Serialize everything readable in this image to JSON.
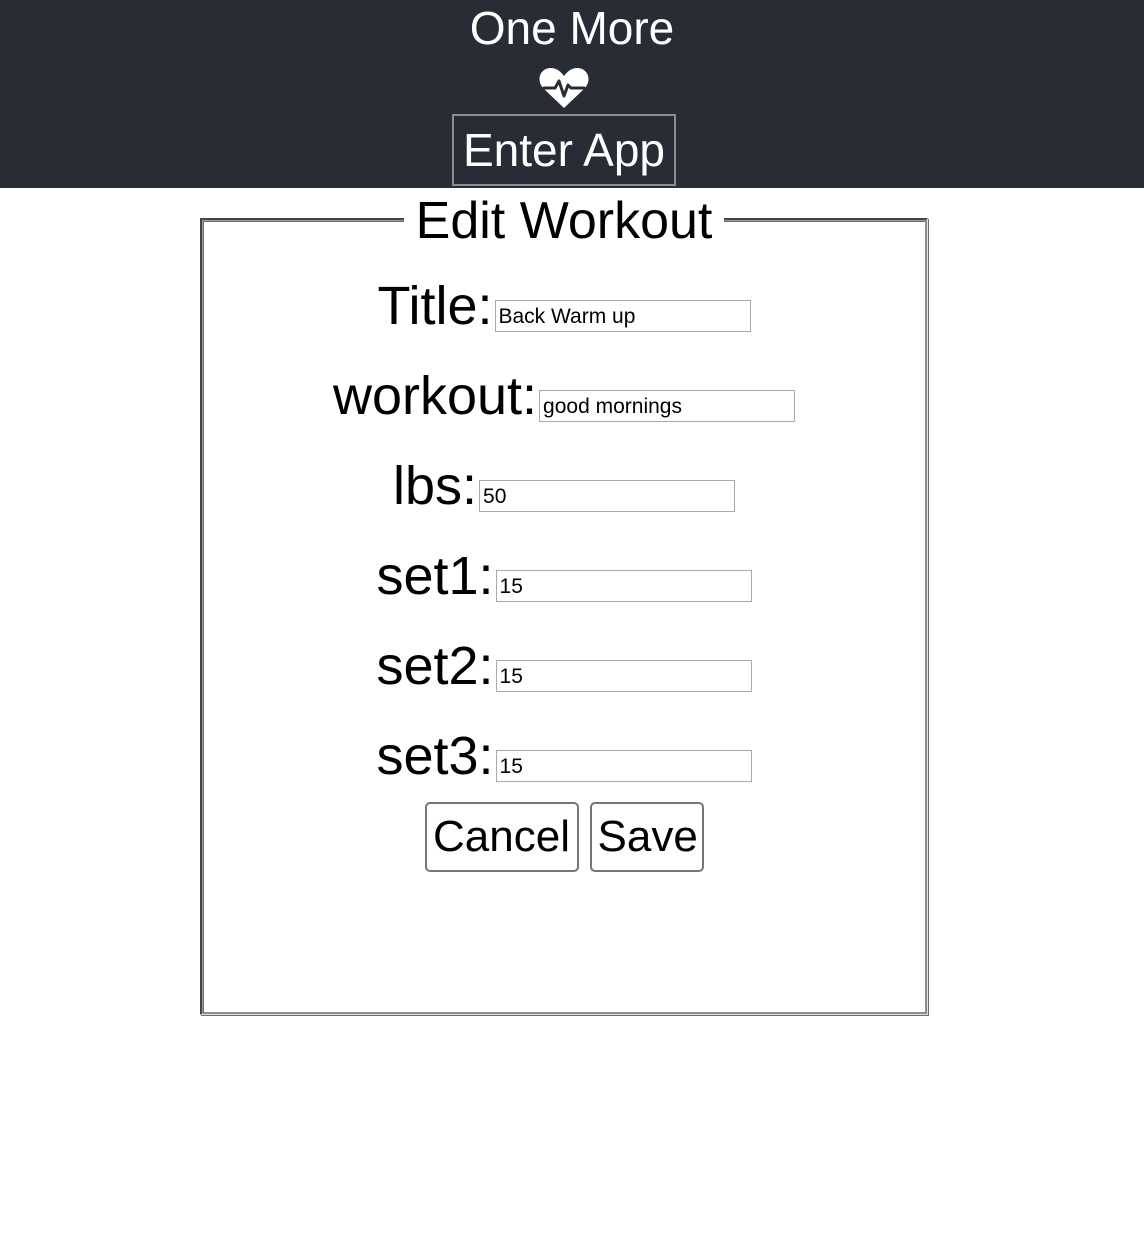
{
  "header": {
    "app_title": "One More",
    "logo_icon": "heartbeat-icon",
    "enter_button_label": "Enter App",
    "background_color": "#282c34"
  },
  "form": {
    "legend": "Edit Workout",
    "fields": [
      {
        "label": "Title:",
        "value": "Back Warm up"
      },
      {
        "label": "workout:",
        "value": "good mornings"
      },
      {
        "label": "lbs:",
        "value": "50"
      },
      {
        "label": "set1:",
        "value": "15"
      },
      {
        "label": "set2:",
        "value": "15"
      },
      {
        "label": "set3:",
        "value": "15"
      }
    ],
    "cancel_label": "Cancel",
    "save_label": "Save"
  }
}
